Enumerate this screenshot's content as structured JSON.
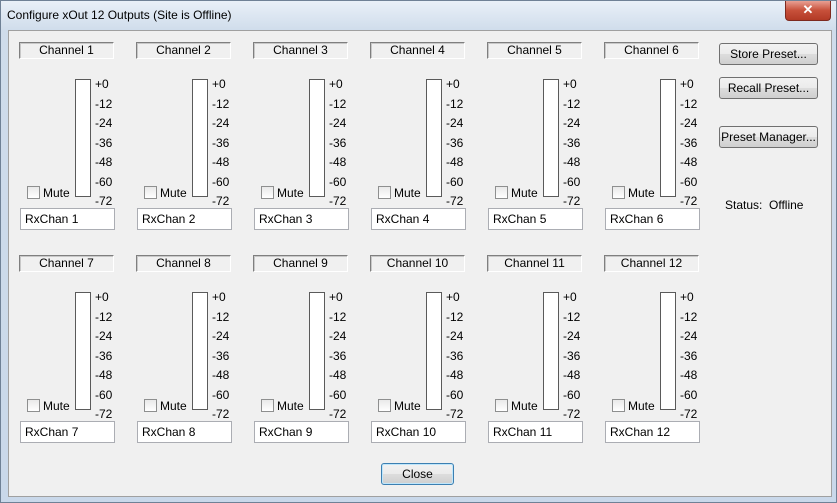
{
  "window": {
    "title": "Configure xOut 12 Outputs (Site is Offline)",
    "close_glyph": "✕"
  },
  "scale": [
    "+0",
    "-12",
    "-24",
    "-36",
    "-48",
    "-60",
    "-72"
  ],
  "mute_label": "Mute",
  "channels": [
    {
      "label": "Channel 1",
      "rx": "RxChan 1",
      "muted": false
    },
    {
      "label": "Channel 2",
      "rx": "RxChan 2",
      "muted": false
    },
    {
      "label": "Channel 3",
      "rx": "RxChan 3",
      "muted": false
    },
    {
      "label": "Channel 4",
      "rx": "RxChan 4",
      "muted": false
    },
    {
      "label": "Channel 5",
      "rx": "RxChan 5",
      "muted": false
    },
    {
      "label": "Channel 6",
      "rx": "RxChan 6",
      "muted": false
    },
    {
      "label": "Channel 7",
      "rx": "RxChan 7",
      "muted": false
    },
    {
      "label": "Channel 8",
      "rx": "RxChan 8",
      "muted": false
    },
    {
      "label": "Channel 9",
      "rx": "RxChan 9",
      "muted": false
    },
    {
      "label": "Channel 10",
      "rx": "RxChan 10",
      "muted": false
    },
    {
      "label": "Channel 11",
      "rx": "RxChan 11",
      "muted": false
    },
    {
      "label": "Channel 12",
      "rx": "RxChan 12",
      "muted": false
    }
  ],
  "buttons": {
    "store": "Store Preset...",
    "recall": "Recall Preset...",
    "manager": "Preset Manager...",
    "close": "Close"
  },
  "status": {
    "label": "Status:",
    "value": "Offline"
  }
}
